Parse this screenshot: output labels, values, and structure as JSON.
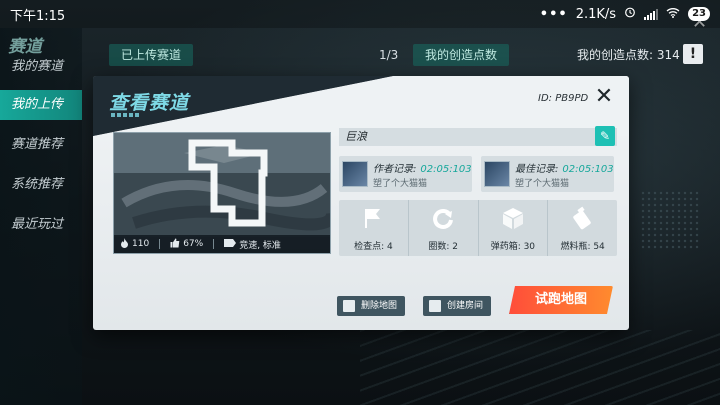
{
  "status_bar": {
    "time": "下午1:15",
    "dots": "•••",
    "net_speed": "2.1K/s",
    "battery": "23"
  },
  "left_menu": {
    "title": "赛道",
    "items": [
      {
        "label": "我的赛道",
        "active": false
      },
      {
        "label": "我的上传",
        "active": true
      },
      {
        "label": "赛道推荐",
        "active": false
      },
      {
        "label": "系统推荐",
        "active": false
      },
      {
        "label": "最近玩过",
        "active": false
      }
    ]
  },
  "top_strip": {
    "uploaded_tab": "已上传赛道",
    "counter": "1/3",
    "points_tab": "我的创造点数",
    "points_label": "我的创造点数: 314",
    "warn_icon": "!"
  },
  "modal": {
    "title": "查看赛道",
    "map_id": "ID: PB9PD",
    "close_icon": "✕",
    "preview": {
      "heat": "110",
      "like_pct": "67%",
      "tags": "竞速, 标准"
    },
    "track_name": "巨浪",
    "edit_icon": "✎",
    "author_record": {
      "label": "作者记录:",
      "time": "02:05:103",
      "user": "塑了个大猫猫"
    },
    "best_record": {
      "label": "最佳记录:",
      "time": "02:05:103",
      "user": "塑了个大猫猫"
    },
    "attrs": [
      {
        "icon": "flag-icon",
        "text": "检查点: 4"
      },
      {
        "icon": "lap-icon",
        "text": "圈数: 2"
      },
      {
        "icon": "crate-icon",
        "text": "弹药箱: 30"
      },
      {
        "icon": "fuel-icon",
        "text": "燃料瓶: 54"
      }
    ],
    "buttons": {
      "delete": "删除地图",
      "create_room": "创建房间",
      "test_run": "试跑地图"
    }
  },
  "colors": {
    "accent_teal": "#16a79b",
    "primary_orange": "#ff6a33",
    "title_cyan": "#7ed9e6"
  }
}
